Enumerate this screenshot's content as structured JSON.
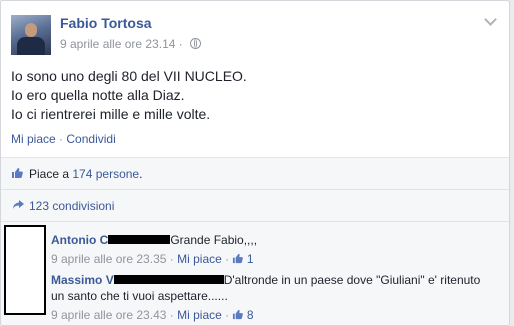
{
  "post": {
    "author": "Fabio Tortosa",
    "timestamp": "9 aprile alle ore 23.14",
    "privacy_icon": "globe-icon",
    "lines": [
      "Io sono uno degli 80 del VII NUCLEO.",
      "Io ero quella notte alla Diaz.",
      "Io ci rientrerei mille e mille volte."
    ],
    "actions": {
      "like": "Mi piace",
      "separator": "·",
      "share": "Condividi"
    }
  },
  "feedback": {
    "likes_prefix": "Piace a",
    "likes_link": "174 persone",
    "likes_suffix": ".",
    "shares_link": "123 condivisioni"
  },
  "comments": [
    {
      "name": "Antonio",
      "name_suffix": "C",
      "text": "Grande Fabio,,,,",
      "text_cont": "",
      "timestamp": "9 aprile alle ore 23.35",
      "separator": "·",
      "like_label": "Mi piace",
      "likes": "1"
    },
    {
      "name": "Massimo",
      "name_suffix": "V",
      "text": "D'altronde in un paese dove \"Giuliani\" e' ritenuto",
      "text_cont": "un santo che ti vuoi aspettare......",
      "timestamp": "9 aprile alle ore 23.43",
      "separator": "·",
      "like_label": "Mi piace",
      "likes": "8"
    }
  ],
  "colors": {
    "link": "#3b5998",
    "meta": "#90949c",
    "feedback_bg": "#f6f7f9"
  }
}
